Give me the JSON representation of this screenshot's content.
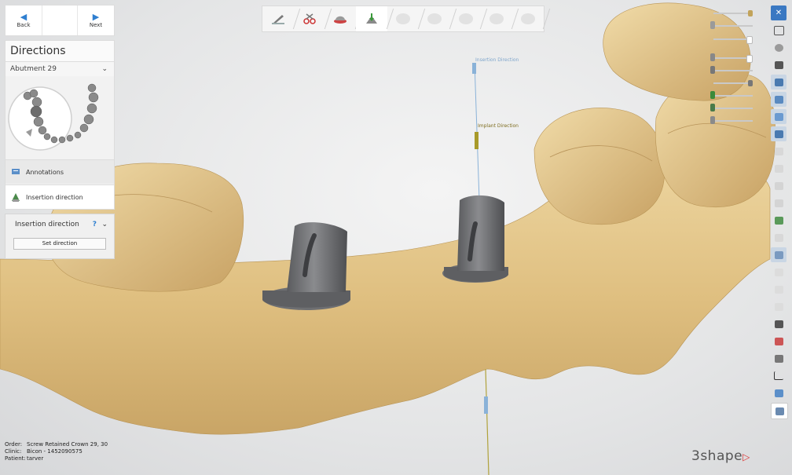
{
  "nav": {
    "back_label": "Back",
    "next_label": "Next"
  },
  "directions": {
    "title": "Directions",
    "selected_tooth": "Abutment 29",
    "items": [
      {
        "label": "Annotations"
      },
      {
        "label": "Insertion direction"
      }
    ]
  },
  "insertion_panel": {
    "title": "Insertion direction",
    "help_icon": "?",
    "set_direction_label": "Set direction"
  },
  "viewport": {
    "insertion_direction_label": "Insertion Direction",
    "implant_direction_label": "Implant Direction"
  },
  "toolbar": {
    "steps": [
      {
        "icon": "brush-icon",
        "active": false
      },
      {
        "icon": "scissors-icon",
        "active": false
      },
      {
        "icon": "margin-icon",
        "active": false
      },
      {
        "icon": "insertion-direction-icon",
        "active": true
      },
      {
        "icon": "tooth-step-icon",
        "active": false
      },
      {
        "icon": "tooth-step-icon",
        "active": false
      },
      {
        "icon": "tooth-step-icon",
        "active": false
      },
      {
        "icon": "tooth-step-icon",
        "active": false
      },
      {
        "icon": "tooth-step-icon",
        "active": false
      }
    ]
  },
  "order_info": {
    "order_key": "Order:",
    "order_value": "Screw Retained Crown 29, 30",
    "clinic_key": "Clinic:",
    "clinic_value": "Bicon - 1452090575",
    "patient_key": "Patient:",
    "patient_value": "tarver"
  },
  "brand": {
    "name": "3shape"
  },
  "colors": {
    "accent_blue": "#2f7fd0",
    "model_gold": "#e6c98c",
    "abutment_gray": "#6f7073",
    "close_blue": "#3a78c2"
  }
}
